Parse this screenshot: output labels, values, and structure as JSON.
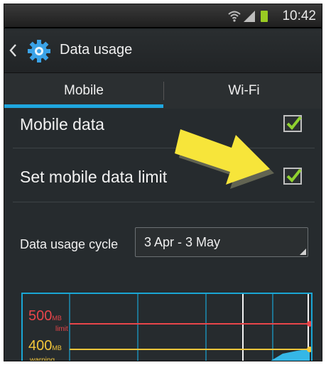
{
  "status_bar": {
    "time": "10:42"
  },
  "action_bar": {
    "title": "Data usage"
  },
  "tabs": [
    {
      "label": "Mobile",
      "selected": true
    },
    {
      "label": "Wi-Fi",
      "selected": false
    }
  ],
  "settings": {
    "mobile_data": {
      "label": "Mobile data",
      "checked": true
    },
    "data_limit": {
      "label": "Set mobile data limit",
      "checked": true
    },
    "cycle": {
      "label": "Data usage cycle",
      "value": "3 Apr - 3 May"
    }
  },
  "chart": {
    "limit_value": "500",
    "limit_unit": "MB",
    "limit_label": "limit",
    "warning_value": "400",
    "warning_unit": "MB",
    "warning_label": "warning"
  },
  "colors": {
    "accent": "#1fa7e0",
    "limit": "#e8454a",
    "warning": "#f3c63a",
    "usage": "#35b7e6",
    "check": "#8fd12f"
  }
}
